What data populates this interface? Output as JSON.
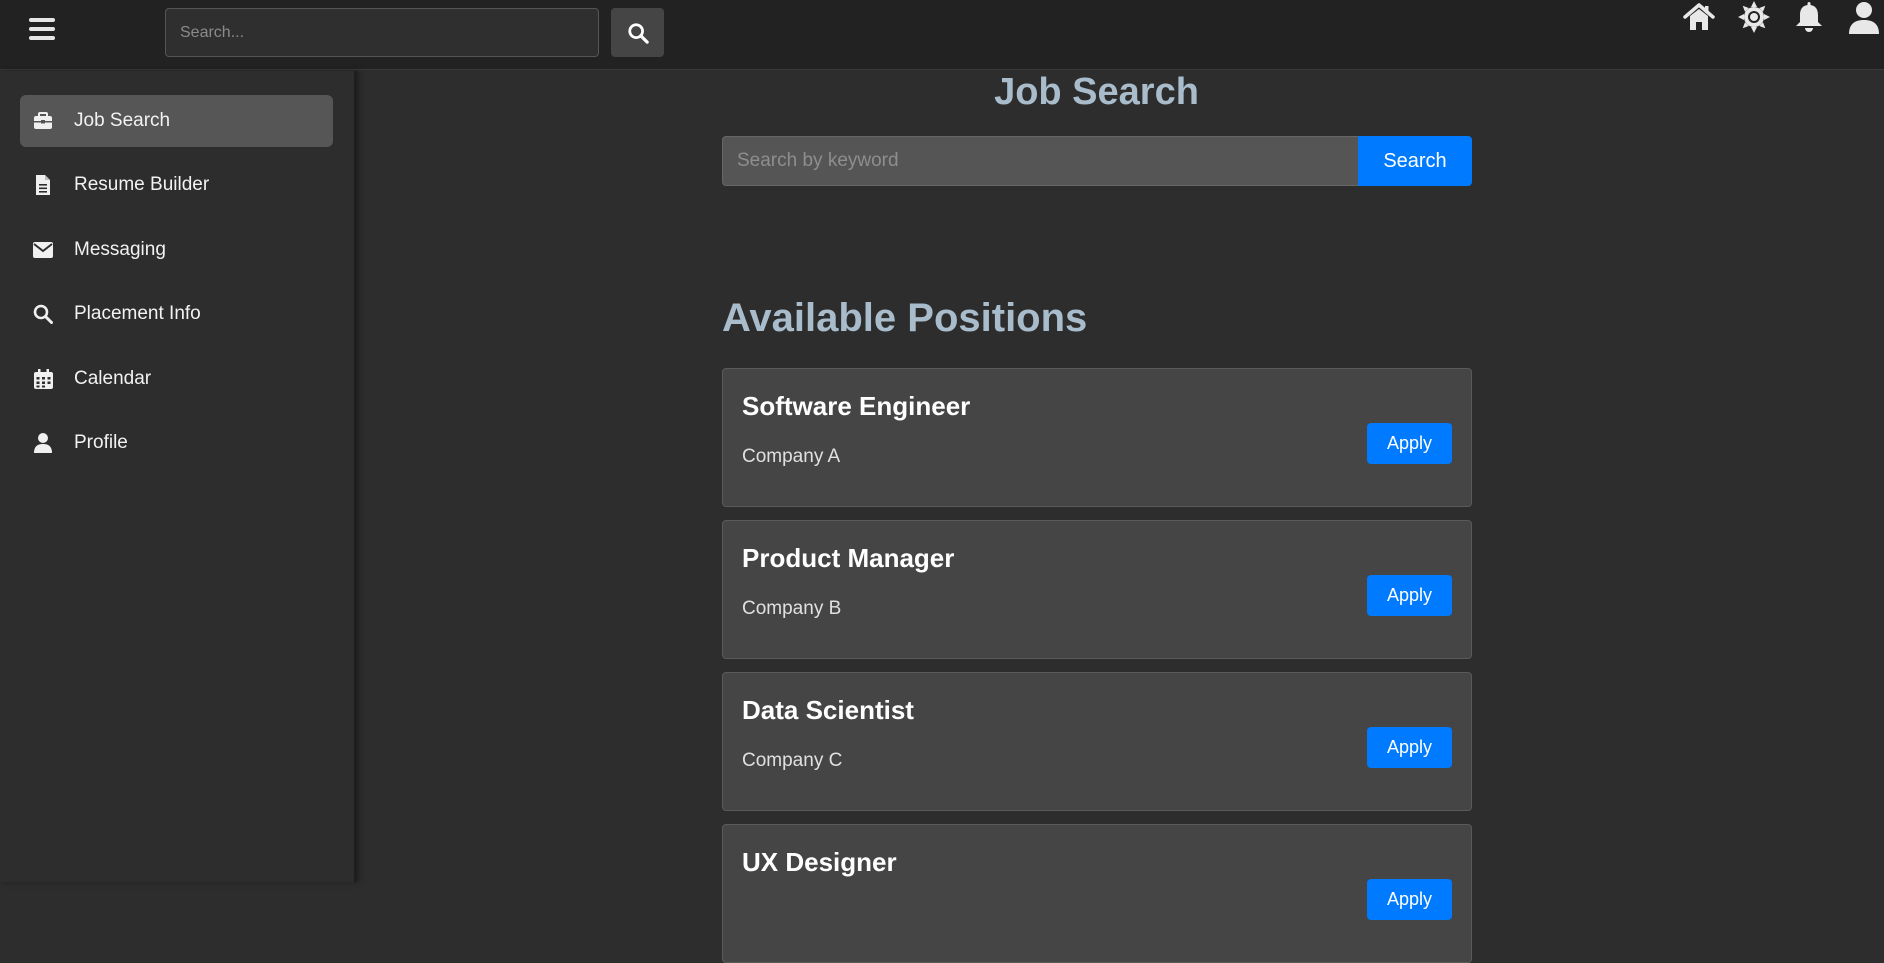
{
  "topbar": {
    "search_placeholder": "Search...",
    "icons": [
      "home-icon",
      "settings-icon",
      "bell-icon",
      "user-icon"
    ]
  },
  "sidebar": {
    "items": [
      {
        "label": "Job Search",
        "icon": "briefcase-icon",
        "active": true
      },
      {
        "label": "Resume Builder",
        "icon": "document-icon",
        "active": false
      },
      {
        "label": "Messaging",
        "icon": "envelope-icon",
        "active": false
      },
      {
        "label": "Placement Info",
        "icon": "search-icon",
        "active": false
      },
      {
        "label": "Calendar",
        "icon": "calendar-icon",
        "active": false
      },
      {
        "label": "Profile",
        "icon": "user-icon",
        "active": false
      }
    ]
  },
  "main": {
    "title": "Job Search",
    "search_placeholder": "Search by keyword",
    "search_button": "Search",
    "section_title": "Available Positions",
    "jobs": [
      {
        "title": "Software Engineer",
        "company": "Company A",
        "apply_label": "Apply"
      },
      {
        "title": "Product Manager",
        "company": "Company B",
        "apply_label": "Apply"
      },
      {
        "title": "Data Scientist",
        "company": "Company C",
        "apply_label": "Apply"
      },
      {
        "title": "UX Designer",
        "company": "",
        "apply_label": "Apply"
      }
    ]
  },
  "colors": {
    "accent": "#007bff",
    "heading": "#a9bccb",
    "background": "#2d2d2d",
    "topbar": "#222222",
    "card": "#454545"
  }
}
